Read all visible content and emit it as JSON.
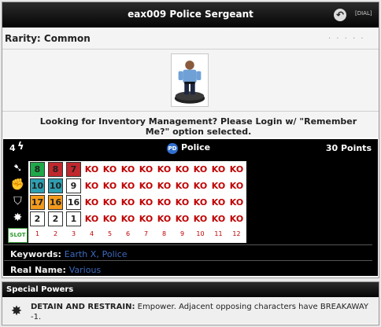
{
  "title": "eax009 Police Sergeant",
  "dial_link": "[DIAL]",
  "rarity": "Rarity: Common",
  "dots": ". . . . .",
  "login_message": "Looking for Inventory Management? Please Login w/ \"Remember Me?\" option selected.",
  "dial": {
    "range": "4",
    "team": "Police",
    "team_badge": "PD",
    "points": "30 Points",
    "slot_label": "SLOT",
    "slots": [
      "1",
      "2",
      "3",
      "4",
      "5",
      "6",
      "7",
      "8",
      "9",
      "10",
      "11",
      "12"
    ],
    "rows": [
      {
        "name": "speed",
        "icon": "boot-icon",
        "cells": [
          "8",
          "8",
          "7",
          "KO",
          "KO",
          "KO",
          "KO",
          "KO",
          "KO",
          "KO",
          "KO",
          "KO"
        ],
        "colors": [
          "#1fa84a",
          "#c1272d",
          "#c1272d",
          "",
          "",
          "",
          "",
          "",
          "",
          "",
          "",
          ""
        ]
      },
      {
        "name": "attack",
        "icon": "fist-icon",
        "cells": [
          "10",
          "10",
          "9",
          "KO",
          "KO",
          "KO",
          "KO",
          "KO",
          "KO",
          "KO",
          "KO",
          "KO"
        ],
        "colors": [
          "#2d9fb0",
          "#2d9fb0",
          "",
          "",
          "",
          "",
          "",
          "",
          "",
          "",
          "",
          ""
        ]
      },
      {
        "name": "defense",
        "icon": "shield-icon",
        "cells": [
          "17",
          "16",
          "16",
          "KO",
          "KO",
          "KO",
          "KO",
          "KO",
          "KO",
          "KO",
          "KO",
          "KO"
        ],
        "colors": [
          "#f39a1c",
          "#f39a1c",
          "",
          "",
          "",
          "",
          "",
          "",
          "",
          "",
          "",
          ""
        ]
      },
      {
        "name": "damage",
        "icon": "burst-icon",
        "cells": [
          "2",
          "2",
          "1",
          "KO",
          "KO",
          "KO",
          "KO",
          "KO",
          "KO",
          "KO",
          "KO",
          "KO"
        ],
        "colors": [
          "",
          "",
          "",
          "",
          "",
          "",
          "",
          "",
          "",
          "",
          "",
          ""
        ]
      }
    ]
  },
  "keywords_label": "Keywords:",
  "keywords": [
    "Earth X",
    "Police"
  ],
  "real_name_label": "Real Name:",
  "real_name": "Various",
  "special_powers_header": "Special Powers",
  "special_power_name": "DETAIN AND RESTRAIN:",
  "special_power_text": "Empower. Adjacent opposing characters have BREAKAWAY -1."
}
